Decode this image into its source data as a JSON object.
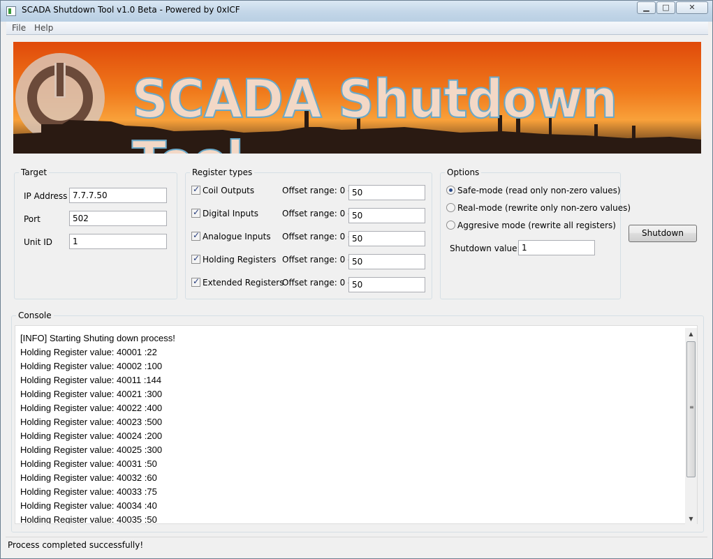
{
  "window": {
    "title": "SCADA Shutdown Tool v1.0 Beta - Powered by 0xICF",
    "minimize": "▁",
    "maximize": "□",
    "close": "✕"
  },
  "menu": {
    "items": [
      "File",
      "Help"
    ]
  },
  "banner": {
    "title": "SCADA Shutdown Tool"
  },
  "target": {
    "legend": "Target",
    "ip_label": "IP Address",
    "ip_value": "7.7.7.50",
    "port_label": "Port",
    "port_value": "502",
    "unit_label": "Unit ID",
    "unit_value": "1"
  },
  "register_types": {
    "legend": "Register types",
    "offset_label": "Offset range: 0 -",
    "items": [
      {
        "label": "Coil Outputs",
        "checked": true,
        "offset": "50"
      },
      {
        "label": "Digital Inputs",
        "checked": true,
        "offset": "50"
      },
      {
        "label": "Analogue Inputs",
        "checked": true,
        "offset": "50"
      },
      {
        "label": "Holding Registers",
        "checked": true,
        "offset": "50"
      },
      {
        "label": "Extended Registers",
        "checked": true,
        "offset": "50"
      }
    ]
  },
  "options": {
    "legend": "Options",
    "modes": [
      {
        "label": "Safe-mode (read only non-zero values)",
        "selected": true
      },
      {
        "label": "Real-mode (rewrite only non-zero values)",
        "selected": false
      },
      {
        "label": "Aggresive mode (rewrite all registers)",
        "selected": false
      }
    ],
    "shutdown_value_label": "Shutdown value:",
    "shutdown_value": "1"
  },
  "shutdown_button": "Shutdown",
  "console": {
    "legend": "Console",
    "lines": [
      "[INFO] Starting Shuting down process!",
      "Holding Register value: 40001 :22",
      "Holding Register value: 40002 :100",
      "Holding Register value: 40011 :144",
      "Holding Register value: 40021 :300",
      "Holding Register value: 40022 :400",
      "Holding Register value: 40023 :500",
      "Holding Register value: 40024 :200",
      "Holding Register value: 40025 :300",
      "Holding Register value: 40031 :50",
      "Holding Register value: 40032 :60",
      "Holding Register value: 40033 :75",
      "Holding Register value: 40034 :40",
      "Holding Register value: 40035 :50"
    ]
  },
  "status": {
    "text": "Process completed successfully!"
  }
}
